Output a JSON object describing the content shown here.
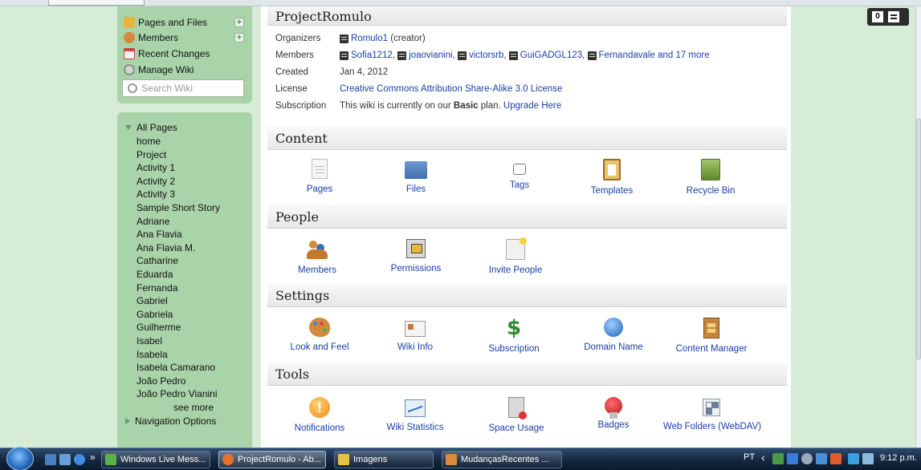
{
  "sidebar": {
    "items": [
      {
        "label": "Pages and Files",
        "icon": "pages-files-icon",
        "has_add": true
      },
      {
        "label": "Members",
        "icon": "members-icon",
        "has_add": true
      },
      {
        "label": "Recent Changes",
        "icon": "calendar-icon",
        "has_add": false
      },
      {
        "label": "Manage Wiki",
        "icon": "gear-icon",
        "has_add": false
      }
    ],
    "search_placeholder": "Search Wiki",
    "all_pages_label": "All Pages",
    "pages": [
      "home",
      "Project",
      "Activity 1",
      "Activity 2",
      "Activity 3",
      "Sample Short Story",
      "Adriane",
      "Ana Flavia",
      "Ana Flavia M.",
      "Catharine",
      "Eduarda",
      "Fernanda",
      "Gabriel",
      "Gabriela",
      "Guilherme",
      "Isabel",
      "Isabela",
      "Isabela Camarano",
      "João Pedro",
      "João Pedro Vianini"
    ],
    "see_more": "see more",
    "navigation_options": "Navigation Options"
  },
  "wiki": {
    "title": "ProjectRomulo",
    "organizers_label": "Organizers",
    "organizer_name": "Romulo1",
    "organizer_role": "(creator)",
    "members_label": "Members",
    "members": [
      "Sofia1212",
      "joaovianini",
      "victorsrb",
      "GuiGADGL123",
      "Fernandavale"
    ],
    "members_more": "and 17 more",
    "created_label": "Created",
    "created_value": "Jan 4, 2012",
    "license_label": "License",
    "license_value": "Creative Commons Attribution Share-Alike 3.0 License",
    "subscription_label": "Subscription",
    "subscription_prefix": "This wiki is currently on our",
    "subscription_plan": "Basic",
    "subscription_suffix": "plan.",
    "upgrade_link": "Upgrade Here"
  },
  "sections": {
    "content": {
      "title": "Content",
      "tools": [
        "Pages",
        "Files",
        "Tags",
        "Templates",
        "Recycle Bin"
      ]
    },
    "people": {
      "title": "People",
      "tools": [
        "Members",
        "Permissions",
        "Invite People"
      ]
    },
    "settings": {
      "title": "Settings",
      "tools": [
        "Look and Feel",
        "Wiki Info",
        "Subscription",
        "Domain Name",
        "Content Manager"
      ]
    },
    "tools": {
      "title": "Tools",
      "tools": [
        "Notifications",
        "Wiki Statistics",
        "Space Usage",
        "Badges",
        "Web Folders (WebDAV)"
      ]
    }
  },
  "notification_badge": {
    "count": "0"
  },
  "taskbar": {
    "quick_launch_chevron": "»",
    "buttons": [
      "Windows Live Mess...",
      "ProjectRomulo - Ab...",
      "Imagens",
      "MudançasRecentes ..."
    ],
    "language": "PT",
    "clock": "9:12 p.m."
  },
  "colors": {
    "link": "#1a3fa8",
    "sidebar_box": "#a9d3a9",
    "page_margin": "#d7ecd7"
  }
}
